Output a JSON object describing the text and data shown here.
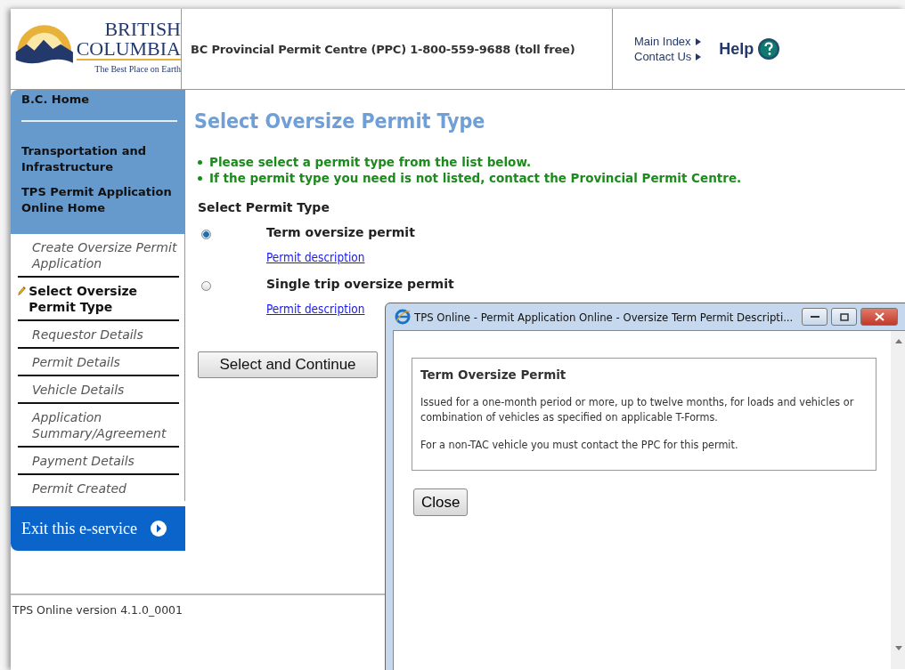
{
  "header": {
    "logo": {
      "line1": "BRITISH",
      "line2": "COLUMBIA",
      "tagline": "The Best Place on Earth"
    },
    "phone": "BC Provincial Permit Centre (PPC) 1-800-559-9688 (toll free)",
    "links": [
      {
        "label": "Main Index"
      },
      {
        "label": "Contact Us"
      }
    ],
    "help": "Help"
  },
  "sidebar": {
    "top_links": [
      "B.C. Home",
      "Transportation and Infrastructure",
      "TPS Permit Application Online Home"
    ],
    "steps": [
      {
        "label": "Create Oversize Permit Application",
        "selected": false
      },
      {
        "label": "Select Oversize Permit Type",
        "selected": true
      },
      {
        "label": "Requestor Details",
        "selected": false
      },
      {
        "label": "Permit Details",
        "selected": false
      },
      {
        "label": "Vehicle Details",
        "selected": false
      },
      {
        "label": "Application Summary/Agreement",
        "selected": false
      },
      {
        "label": "Payment Details",
        "selected": false
      },
      {
        "label": "Permit Created",
        "selected": false
      }
    ],
    "exit": "Exit this e-service"
  },
  "main": {
    "title": "Select Oversize Permit Type",
    "notes": [
      "Please select a permit type from the list below.",
      "If the permit type you need is not listed, contact the Provincial Permit Centre."
    ],
    "section_label": "Select Permit Type",
    "options": [
      {
        "label": "Term oversize permit",
        "selected": true,
        "link": "Permit description"
      },
      {
        "label": "Single trip oversize permit",
        "selected": false,
        "link": "Permit description"
      }
    ],
    "button": "Select and Continue"
  },
  "footer": {
    "version": "TPS Online version 4.1.0_0001"
  },
  "popup": {
    "title": "TPS Online - Permit Application Online - Oversize Term Permit Descripti...",
    "heading": "Term Oversize Permit",
    "paragraphs": [
      "Issued for a one-month period or more, up to twelve months, for loads and vehicles or combination of vehicles as specified on applicable T-Forms.",
      "For a non-TAC vehicle you must contact the PPC for this permit."
    ],
    "close": "Close"
  }
}
